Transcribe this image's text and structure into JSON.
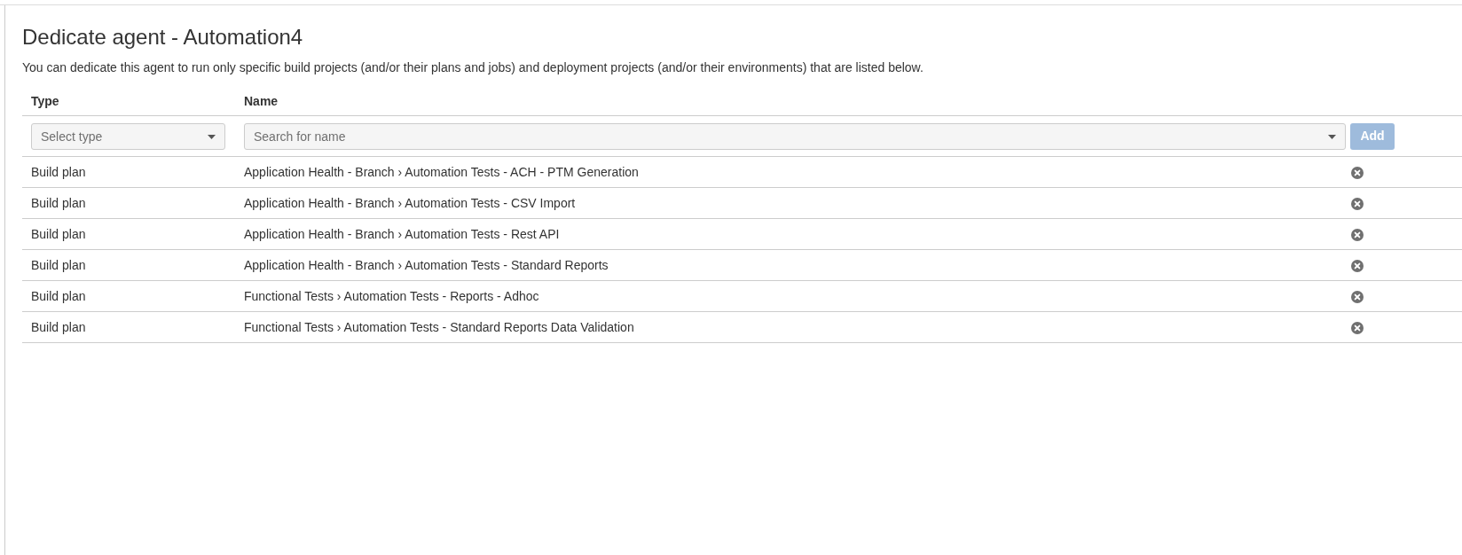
{
  "page": {
    "title": "Dedicate agent - Automation4",
    "description": "You can dedicate this agent to run only specific build projects (and/or their plans and jobs) and deployment projects (and/or their environments) that are listed below."
  },
  "table": {
    "columns": [
      "Type",
      "Name"
    ],
    "filter": {
      "type_select": {
        "placeholder": "Select type"
      },
      "name_search": {
        "placeholder": "Search for name"
      },
      "add_button": {
        "label": "Add",
        "disabled": true
      }
    },
    "rows": [
      {
        "type": "Build plan",
        "name": "Application Health - Branch › Automation Tests - ACH - PTM Generation"
      },
      {
        "type": "Build plan",
        "name": "Application Health - Branch › Automation Tests - CSV Import"
      },
      {
        "type": "Build plan",
        "name": "Application Health - Branch › Automation Tests - Rest API"
      },
      {
        "type": "Build plan",
        "name": "Application Health - Branch › Automation Tests - Standard Reports"
      },
      {
        "type": "Build plan",
        "name": "Functional Tests › Automation Tests - Reports - Adhoc"
      },
      {
        "type": "Build plan",
        "name": "Functional Tests › Automation Tests - Standard Reports Data Validation"
      }
    ]
  }
}
